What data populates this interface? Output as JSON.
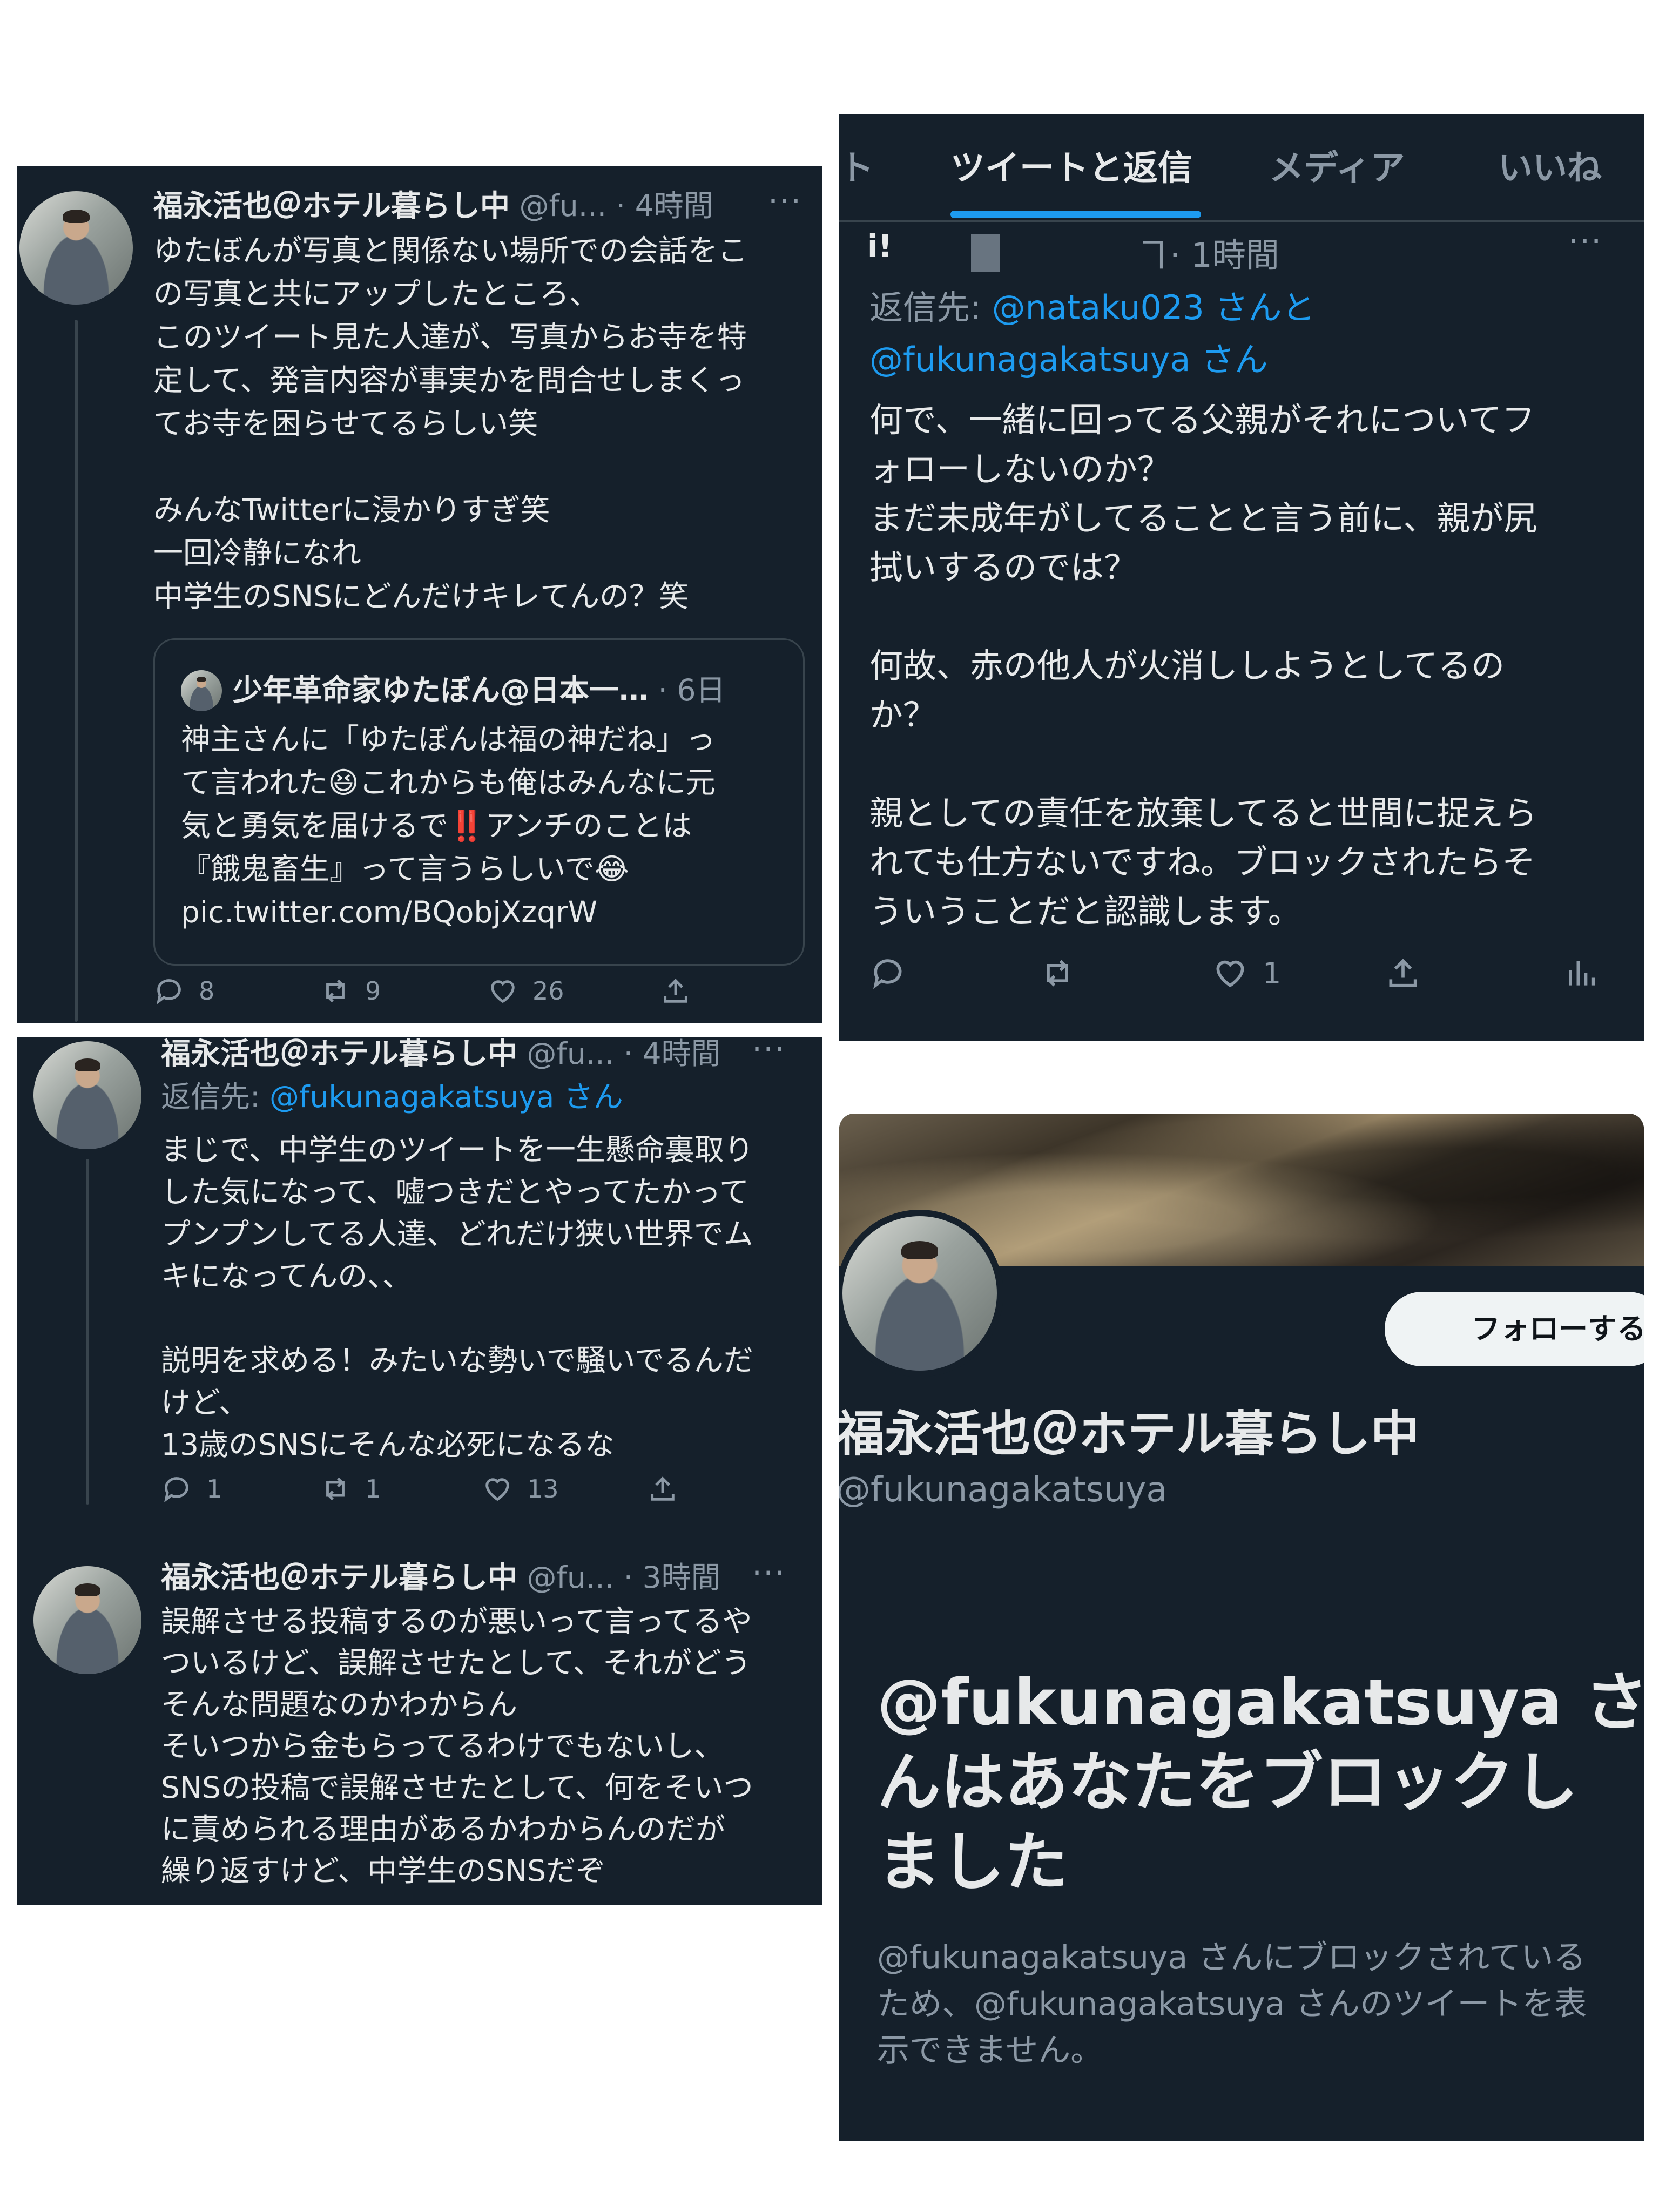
{
  "panel1": {
    "name": "福永活也＠ホテル暮らし中",
    "meta": "@fu... · 4時間",
    "more": "···",
    "lines": [
      "ゆたぼんが写真と関係ない場所での会話をこ",
      "の写真と共にアップしたところ、",
      "このツイート見た人達が、写真からお寺を特",
      "定して、発言内容が事実かを問合せしまくっ",
      "てお寺を困らせてるらしい笑",
      "",
      "みんなTwitterに浸かりすぎ笑",
      "一回冷静になれ",
      "中学生のSNSにどんだけキレてんの？笑"
    ],
    "quote": {
      "name": "少年革命家ゆたぼん@日本一…",
      "meta": "· 6日",
      "lines": [
        "神主さんに「ゆたぼんは福の神だね」っ",
        "て言われた😆これからも俺はみんなに元",
        "気と勇気を届けるで‼️アンチのことは",
        "『餓鬼畜生』って言うらしいで😂",
        "pic.twitter.com/BQobjXzqrW"
      ]
    },
    "replies": "8",
    "retweets": "9",
    "likes": "26"
  },
  "panel2": {
    "tabs": [
      "ト",
      "ツイートと返信",
      "メディア",
      "いいね"
    ],
    "user_fragment": "i!",
    "meta": "ヿ· 1時間",
    "more": "···",
    "reply_prefix": "返信先: ",
    "reply_user1": "@nataku023",
    "reply_mid": " さんと",
    "reply_user2": "@fukunagakatsuya",
    "reply_suffix": " さん",
    "lines": [
      "何で、一緒に回ってる父親がそれについてフ",
      "ォローしないのか？",
      "まだ未成年がしてることと言う前に、親が尻",
      "拭いするのでは？",
      "",
      "何故、赤の他人が火消ししようとしてるの",
      "か？",
      "",
      "親としての責任を放棄してると世間に捉えら",
      "れても仕方ないですね。ブロックされたらそ",
      "ういうことだと認識します。"
    ],
    "likes": "1"
  },
  "panel3": {
    "tweet1": {
      "name": "福永活也＠ホテル暮らし中",
      "meta": "@fu... · 4時間",
      "more": "···",
      "reply_prefix": "返信先: ",
      "reply_user": "@fukunagakatsuya",
      "reply_suffix": " さん",
      "lines": [
        "まじで、中学生のツイートを一生懸命裏取り",
        "した気になって、嘘つきだとやってたかって",
        "プンプンしてる人達、どれだけ狭い世界でム",
        "キになってんの、、",
        "",
        "説明を求める！みたいな勢いで騒いでるんだ",
        "けど、",
        "13歳のSNSにそんな必死になるな"
      ],
      "replies": "1",
      "retweets": "1",
      "likes": "13"
    },
    "tweet2": {
      "name": "福永活也＠ホテル暮らし中",
      "meta": "@fu... · 3時間",
      "more": "···",
      "lines": [
        "誤解させる投稿するのが悪いって言ってるや",
        "ついるけど、誤解させたとして、それがどう",
        "そんな問題なのかわからん",
        "そいつから金もらってるわけでもないし、",
        "SNSの投稿で誤解させたとして、何をそいつ",
        "に責められる理由があるかわからんのだが",
        "繰り返すけど、中学生のSNSだぞ"
      ]
    }
  },
  "panel4": {
    "follow_label": "フォローする",
    "display_name": "福永活也＠ホテル暮らし中",
    "handle": "@fukunagakatsuya",
    "blocked_title_lines": [
      "@fukunagakatsuya さ",
      "んはあなたをブロックし",
      "ました"
    ],
    "blocked_desc_lines": [
      "@fukunagakatsuya さんにブロックされている",
      "ため、@fukunagakatsuya さんのツイートを表",
      "示できません。"
    ]
  },
  "colors": {
    "background": "#15202b",
    "text": "#e7e9ea",
    "secondary": "#8b98a5",
    "accent": "#1d9bf0",
    "border": "#38444d"
  }
}
